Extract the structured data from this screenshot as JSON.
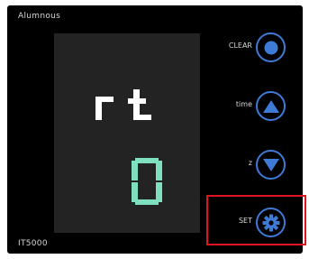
{
  "device": {
    "name": "Alumnous",
    "model": "IT5000"
  },
  "display": {
    "line1": "rt",
    "line2": "0",
    "line1_color": "#ffffff",
    "line2_color": "#7fe0c0"
  },
  "controls": [
    {
      "label": "CLEAR",
      "icon": "circle-icon"
    },
    {
      "label": "time",
      "icon": "up-triangle-icon"
    },
    {
      "label": "z",
      "icon": "down-triangle-icon"
    },
    {
      "label": "SET",
      "icon": "gear-icon"
    }
  ],
  "colors": {
    "accent": "#3d7bd6",
    "highlight": "#e0141e",
    "panel": "#000000",
    "screen": "#232323"
  }
}
